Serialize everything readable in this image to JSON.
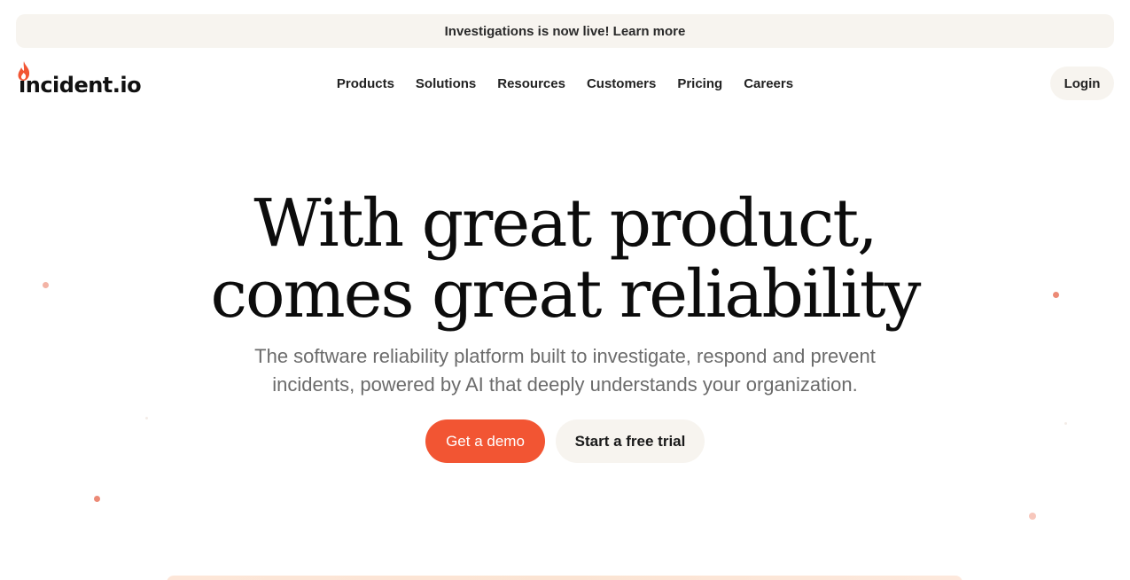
{
  "announcement": {
    "text": "Investigations is now live! Learn more"
  },
  "brand": {
    "name": "incident.io",
    "accent_color": "#f25533"
  },
  "nav": {
    "items": [
      {
        "label": "Products"
      },
      {
        "label": "Solutions"
      },
      {
        "label": "Resources"
      },
      {
        "label": "Customers"
      },
      {
        "label": "Pricing"
      },
      {
        "label": "Careers"
      }
    ],
    "login_label": "Login"
  },
  "hero": {
    "title_line1": "With great product,",
    "title_line2": "comes great reliability",
    "subtitle_line1": "The software reliability platform built to investigate, respond and prevent",
    "subtitle_line2": "incidents, powered by AI that deeply understands your organization.",
    "primary_cta": "Get a demo",
    "secondary_cta": "Start a free trial"
  },
  "colors": {
    "primary_button": "#f25533",
    "soft_surface": "#f7f4ef",
    "decor_dot": "#f0a08e"
  },
  "icons": {
    "logo": "flame-icon"
  }
}
